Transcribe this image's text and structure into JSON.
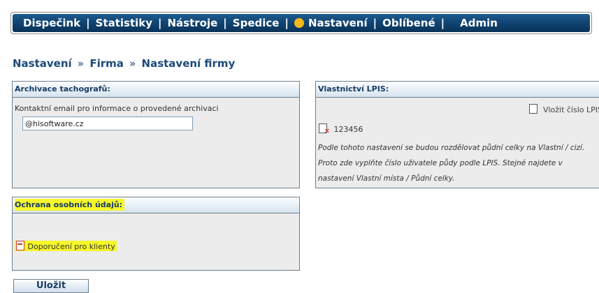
{
  "nav": {
    "items": [
      "Dispečink",
      "Statistiky",
      "Nástroje",
      "Spedice",
      "Nastavení",
      "Oblíbené",
      "Admin"
    ],
    "separator": "|",
    "active_dot_color": "#f3b81a"
  },
  "breadcrumb": {
    "parts": [
      "Nastavení",
      "Firma",
      "Nastavení firmy"
    ],
    "separator": "»"
  },
  "tacho": {
    "title": "Archivace tachografů:",
    "label": "Kontaktní email pro informace o provedené archivaci",
    "email_value": "@hisoftware.cz"
  },
  "lpis": {
    "title": "Vlastnictví LPIS:",
    "add_label": "Vložit číslo LPIS",
    "entry": "123456",
    "note_lines": [
      "Podle tohoto nastavení se budou rozdělovat půdní celky na Vlastní / cizí.",
      "Proto zde vyplňte číslo uživatele půdy podle LPIS. Stejné najdete v",
      "nastavení Vlastní místa / Půdní celky."
    ]
  },
  "gdpr": {
    "title": "Ochrana osobních údajů:",
    "link_label": "Doporučení pro klienty"
  },
  "actions": {
    "save_label": "Uložit"
  },
  "colors": {
    "nav_bg": "#0e3f6c",
    "highlight": "#f6f62a",
    "title_text": "#1d4a7a"
  }
}
